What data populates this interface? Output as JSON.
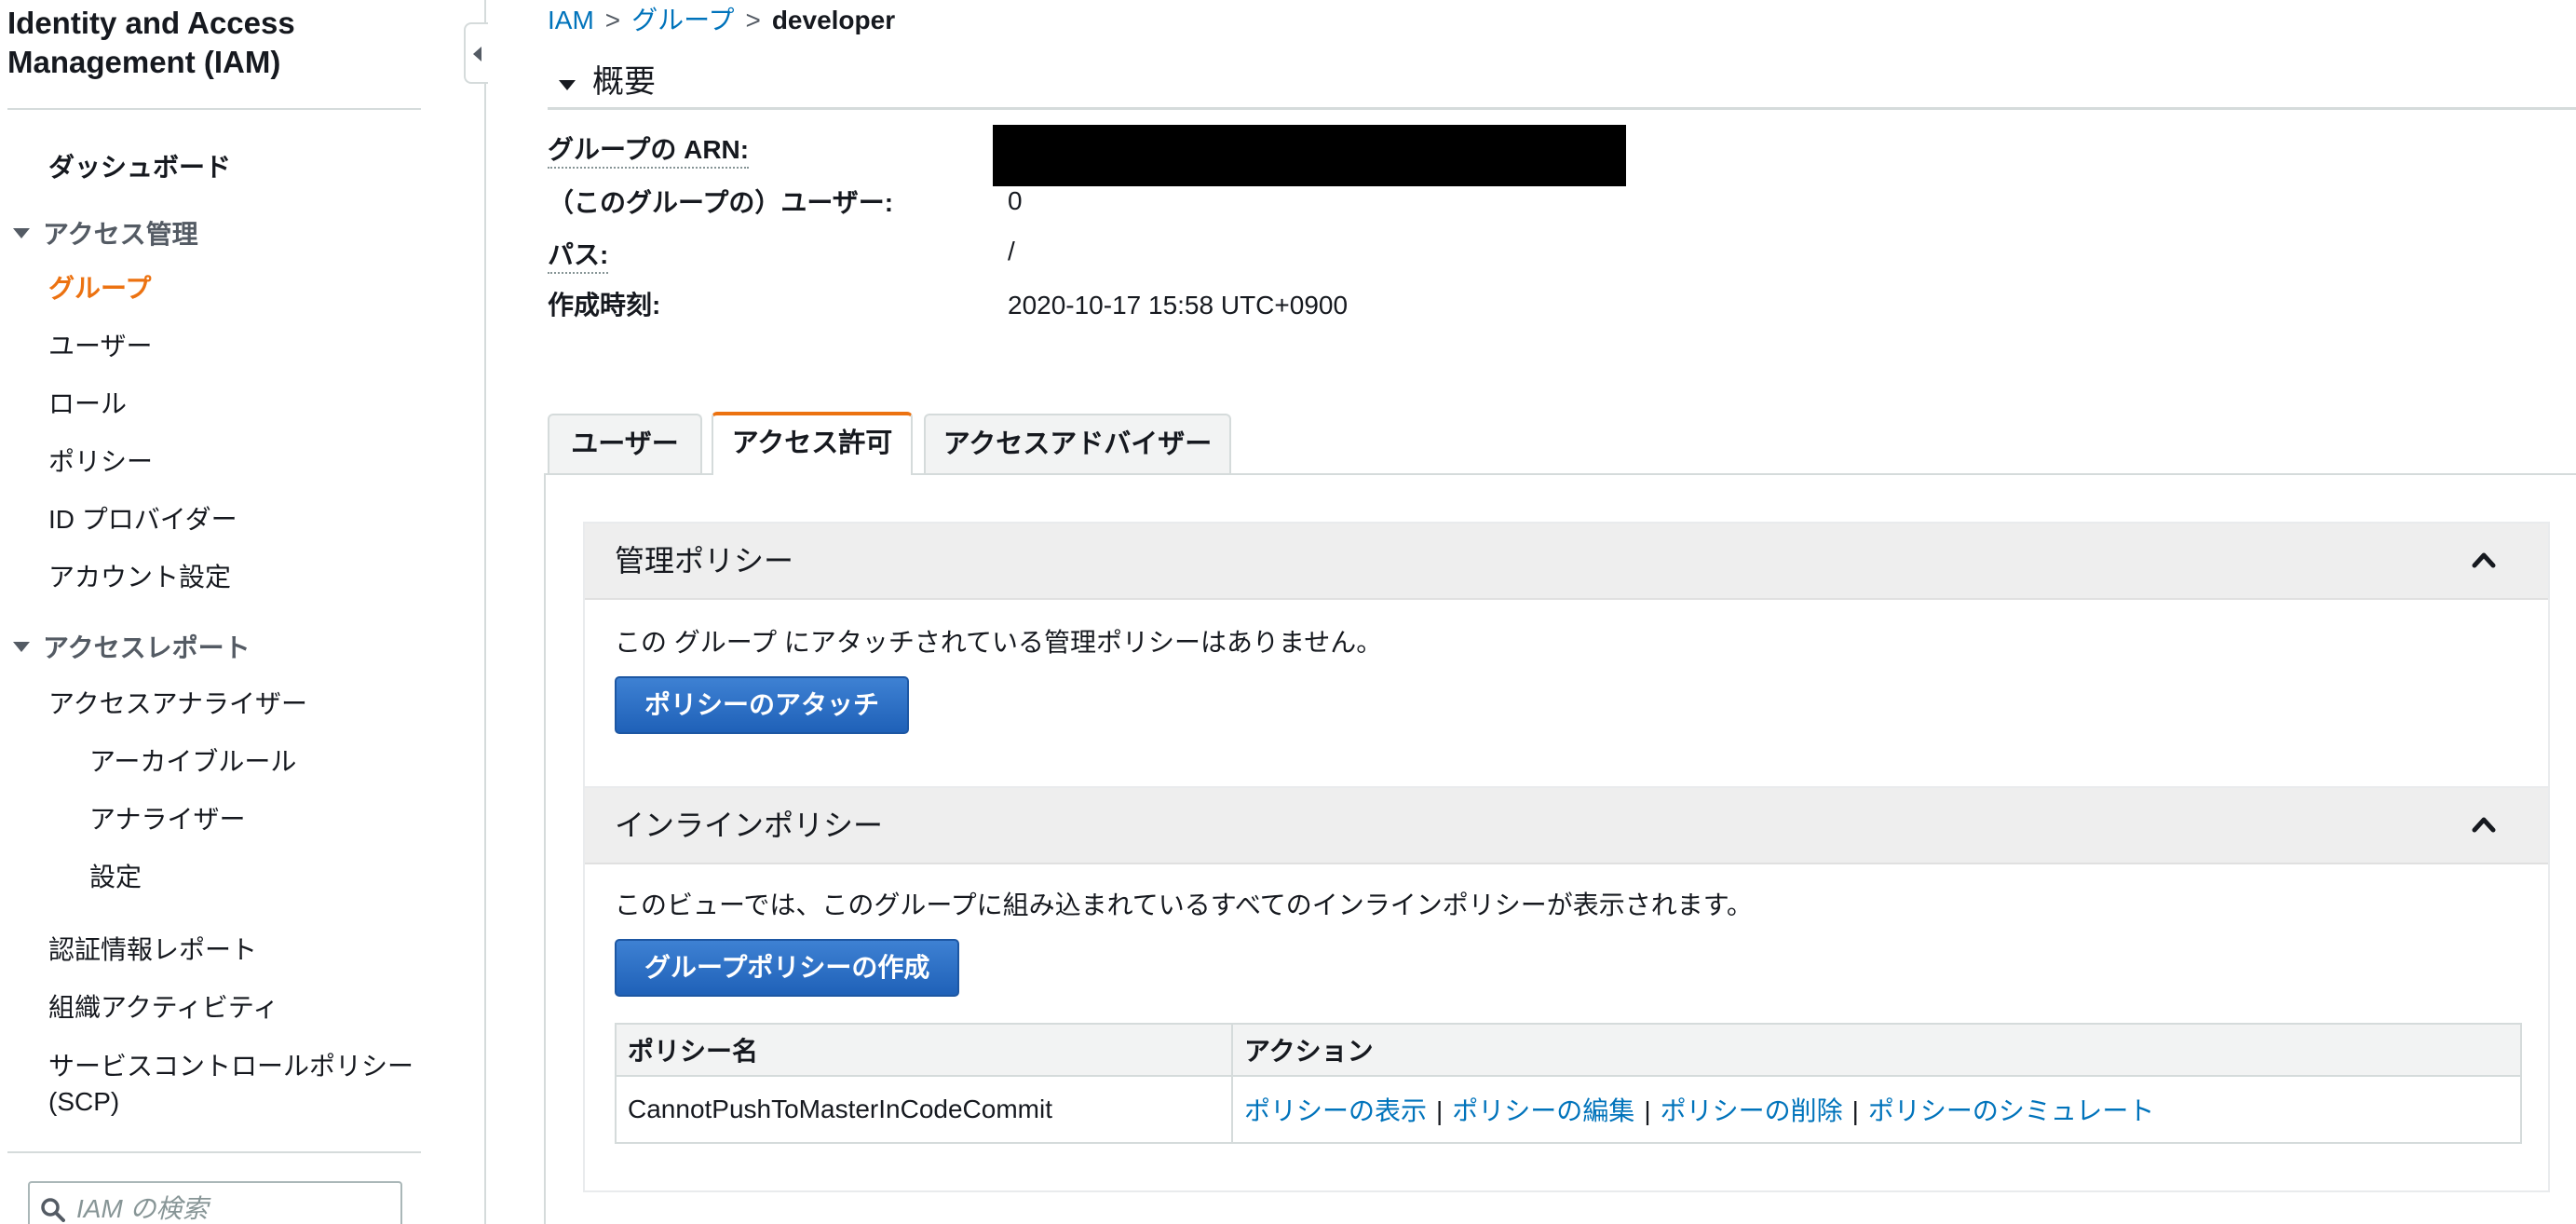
{
  "sidebar": {
    "title_line1": "Identity and Access",
    "title_line2": "Management (IAM)",
    "dashboard": "ダッシュボード",
    "section_access_management": "アクセス管理",
    "groups": "グループ",
    "users": "ユーザー",
    "roles": "ロール",
    "policies": "ポリシー",
    "id_providers": "ID プロバイダー",
    "account_settings": "アカウント設定",
    "section_access_reports": "アクセスレポート",
    "access_analyzer": "アクセスアナライザー",
    "archive_rules": "アーカイブルール",
    "analyzers": "アナライザー",
    "settings": "設定",
    "credential_report": "認証情報レポート",
    "org_activity": "組織アクティビティ",
    "scp_line1": "サービスコントロールポリシー",
    "scp_line2": "(SCP)",
    "search_placeholder": "IAM の検索"
  },
  "breadcrumb": {
    "root": "IAM",
    "separator": ">",
    "groups": "グループ",
    "current": "developer"
  },
  "summary": {
    "title": "概要",
    "arn_label": "グループの ARN:",
    "users_label": "（このグループの）ユーザー:",
    "users_value": "0",
    "path_label": "パス:",
    "path_value": "/",
    "created_label": "作成時刻:",
    "created_value": "2020-10-17 15:58 UTC+0900"
  },
  "tabs": {
    "users": "ユーザー",
    "permissions": "アクセス許可",
    "access_advisor": "アクセスアドバイザー"
  },
  "managed_policies": {
    "title": "管理ポリシー",
    "message": "この グループ にアタッチされている管理ポリシーはありません。",
    "attach_button": "ポリシーのアタッチ"
  },
  "inline_policies": {
    "title": "インラインポリシー",
    "message": "このビューでは、このグループに組み込まれているすべてのインラインポリシーが表示されます。",
    "create_button": "グループポリシーの作成",
    "col_policy_name": "ポリシー名",
    "col_actions": "アクション",
    "rows": [
      {
        "name": "CannotPushToMasterInCodeCommit",
        "show": "ポリシーの表示",
        "edit": "ポリシーの編集",
        "delete": "ポリシーの削除",
        "simulate": "ポリシーのシミュレート",
        "sep": "|"
      }
    ]
  },
  "colors": {
    "accent_orange": "#ec7211",
    "link_blue": "#0073bb",
    "button_blue": "#1f61b8"
  }
}
